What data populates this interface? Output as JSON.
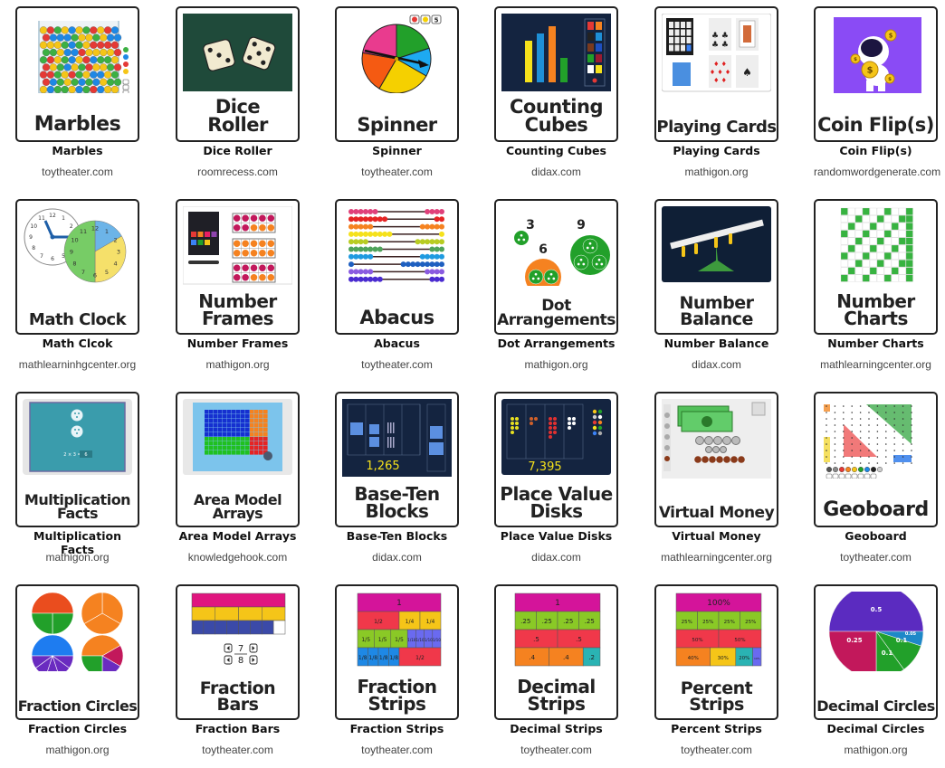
{
  "tools": [
    {
      "title": "Marbles",
      "card_label": "Marbles",
      "site": "toytheater.com",
      "icon": "marbles-jar-icon"
    },
    {
      "title": "Dice Roller",
      "card_label": "Dice\nRoller",
      "site": "roomrecess.com",
      "icon": "dice-icon"
    },
    {
      "title": "Spinner",
      "card_label": "Spinner",
      "site": "toytheater.com",
      "icon": "spinner-wheel-icon",
      "badge": "5"
    },
    {
      "title": "Counting Cubes",
      "card_label": "Counting\nCubes",
      "site": "didax.com",
      "icon": "counting-cubes-icon"
    },
    {
      "title": "Playing Cards",
      "card_label": "Playing Cards",
      "site": "mathigon.org",
      "icon": "playing-cards-icon"
    },
    {
      "title": "Coin Flip(s)",
      "card_label": "Coin Flip(s)",
      "site": "randomwordgenerate.com",
      "icon": "astronaut-coins-icon"
    },
    {
      "title": "Math Clcok",
      "card_label": "Math Clock",
      "site": "mathlearninhgcenter.org",
      "icon": "clock-icon"
    },
    {
      "title": "Number Frames",
      "card_label": "Number\nFrames",
      "site": "mathigon.org",
      "icon": "ten-frames-icon"
    },
    {
      "title": "Abacus",
      "card_label": "Abacus",
      "site": "toytheater.com",
      "icon": "abacus-icon"
    },
    {
      "title": "Dot Arrangements",
      "card_label": "Dot\nArrangements",
      "site": "mathigon.org",
      "icon": "dot-groups-icon",
      "numbers": [
        "3",
        "6",
        "9"
      ]
    },
    {
      "title": "Number Balance",
      "card_label": "Number\nBalance",
      "site": "didax.com",
      "icon": "balance-scale-icon"
    },
    {
      "title": "Number Charts",
      "card_label": "Number\nCharts",
      "site": "mathlearningcenter.org",
      "icon": "hundred-chart-icon"
    },
    {
      "title": "Multiplication Facts",
      "card_label": "Multiplication\nFacts",
      "site": "mathigon.org",
      "icon": "multiplication-screen-icon",
      "equation": "2 × 3 =",
      "answer": "6"
    },
    {
      "title": "Area Model Arrays",
      "card_label": "Area Model\nArrays",
      "site": "knowledgehook.com",
      "icon": "area-model-icon"
    },
    {
      "title": "Base-Ten Blocks",
      "card_label": "Base-Ten\nBlocks",
      "site": "didax.com",
      "icon": "base-ten-blocks-icon",
      "value": "1,265"
    },
    {
      "title": "Place Value Disks",
      "card_label": "Place Value\nDisks",
      "site": "didax.com",
      "icon": "place-value-disks-icon",
      "value": "7,395"
    },
    {
      "title": "Virtual Money",
      "card_label": "Virtual Money",
      "site": "mathlearningcenter.org",
      "icon": "money-icon"
    },
    {
      "title": "Geoboard",
      "card_label": "Geoboard",
      "site": "toytheater.com",
      "icon": "geoboard-icon"
    },
    {
      "title": "Fraction Circles",
      "card_label": "Fraction Circles",
      "site": "mathigon.org",
      "icon": "fraction-circles-icon"
    },
    {
      "title": "Fraction Bars",
      "card_label": "Fraction\nBars",
      "site": "toytheater.com",
      "icon": "fraction-bars-icon",
      "numerator": "7",
      "denominator": "8"
    },
    {
      "title": "Fraction Strips",
      "card_label": "Fraction\nStrips",
      "site": "toytheater.com",
      "icon": "fraction-strips-icon",
      "rows": [
        [
          "1"
        ],
        [
          "1/2",
          "1/4",
          "1/4"
        ],
        [
          "1/5",
          "1/5",
          "1/5",
          "1/10",
          "1/10",
          "1/10",
          "1/10"
        ],
        [
          "1/8",
          "1/8",
          "1/8",
          "1/8",
          "1/2"
        ]
      ]
    },
    {
      "title": "Decimal Strips",
      "card_label": "Decimal\nStrips",
      "site": "toytheater.com",
      "icon": "decimal-strips-icon",
      "rows": [
        [
          "1"
        ],
        [
          ".25",
          ".25",
          ".25",
          ".25"
        ],
        [
          ".5",
          ".5"
        ],
        [
          ".4",
          ".4",
          ".2"
        ]
      ]
    },
    {
      "title": "Percent Strips",
      "card_label": "Percent\nStrips",
      "site": "toytheater.com",
      "icon": "percent-strips-icon",
      "rows": [
        [
          "100%"
        ],
        [
          "25%",
          "25%",
          "25%",
          "25%"
        ],
        [
          "50%",
          "50%"
        ],
        [
          "40%",
          "30%",
          "20%",
          "10%"
        ]
      ]
    },
    {
      "title": "Decimal Circles",
      "card_label": "Decimal Circles",
      "site": "mathigon.org",
      "icon": "decimal-pie-icon",
      "slices": [
        {
          "label": "0.5",
          "value": 0.5
        },
        {
          "label": "0.05",
          "value": 0.05
        },
        {
          "label": "0.1",
          "value": 0.1
        },
        {
          "label": "0.1",
          "value": 0.1
        },
        {
          "label": "0.25",
          "value": 0.25
        }
      ]
    }
  ],
  "colors": {
    "pink": "#e0157f",
    "yellow": "#f5c518",
    "navy": "#3b4aa8",
    "red": "#ee3344",
    "green": "#22a02a",
    "blue": "#1e88e5",
    "orange": "#f58220",
    "purple": "#5b2bc0",
    "teal": "#2ab3b3",
    "dark_panel": "#142440"
  }
}
